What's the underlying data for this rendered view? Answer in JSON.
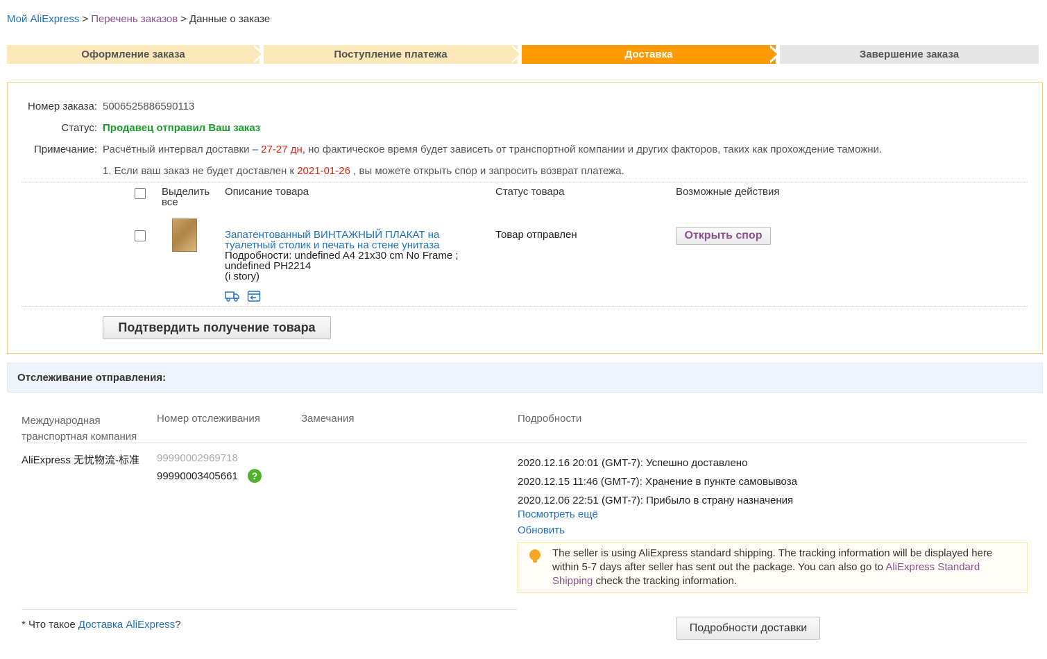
{
  "breadcrumb": {
    "home": "Мой AliExpress",
    "orders": "Перечень заказов",
    "current": "Данные о заказе",
    "separator": ">"
  },
  "steps": [
    {
      "label": "Оформление заказа",
      "state": "done"
    },
    {
      "label": "Поступление платежа",
      "state": "done"
    },
    {
      "label": "Доставка",
      "state": "active"
    },
    {
      "label": "Завершение заказа",
      "state": "todo"
    }
  ],
  "order": {
    "number_label": "Номер заказа:",
    "number": "5006525886590113",
    "status_label": "Статус:",
    "status": "Продавец отправил Ваш заказ",
    "note_label": "Примечание:",
    "note_prefix": "Расчётный интервал доставки – ",
    "note_interval": "27-27 дн",
    "note_suffix": ", но фактическое время будет зависеть от транспортной компании и других факторов, таких как прохождение таможни.",
    "dispute_prefix": "1. Если ваш заказ не будет доставлен к ",
    "dispute_date": "2021-01-26",
    "dispute_suffix": " , вы можете открыть спор и запросить возврат платежа."
  },
  "products": {
    "select_all": "Выделить все",
    "col_description": "Описание товара",
    "col_status": "Статус товара",
    "col_actions": "Возможные действия",
    "item": {
      "title": "Запатентованный ВИНТАЖНЫЙ ПЛАКАТ на туалетный столик и печать на стене унитаза",
      "details_line1": "Подробности: undefined A4 21x30 cm No Frame   ;",
      "details_line2": "undefined PH2214",
      "store": "(i story)",
      "status": "Товар отправлен",
      "action": "Открыть спор"
    },
    "confirm_button": "Подтвердить получение товара"
  },
  "tracking": {
    "title": "Отслеживание отправления:",
    "col_carrier_1": "Международная",
    "col_carrier_2": "транспортная компания",
    "col_number": "Номер отслеживания",
    "col_remarks": "Замечания",
    "col_details": "Подробности",
    "carrier": "AliExpress 无忧物流-标准",
    "old_number": "99990002969718",
    "number": "99990003405661",
    "events": [
      "2020.12.16 20:01 (GMT-7): Успешно доставлено",
      "2020.12.15 11:46 (GMT-7): Хранение в пункте самовывоза",
      "2020.12.06 22:51 (GMT-7): Прибыло в страну назначения"
    ],
    "more_link": "Посмотреть ещё",
    "refresh_link": "Обновить",
    "notice_text": "The seller is using AliExpress standard shipping. The tracking information will be displayed here within 5-7 days after seller has sent out the package. You can also go to ",
    "notice_link": "AliExpress Standard Shipping",
    "notice_suffix": " check the tracking information.",
    "faq_prefix": "* Что такое ",
    "faq_link": "Доставка AliExpress",
    "faq_suffix": "?",
    "details_button": "Подробности доставки"
  },
  "colors": {
    "step_done": "#fde8b9",
    "step_active": "#ff9b00",
    "step_todo": "#e6e6e6",
    "status_green": "#1a9c2c",
    "highlight_red": "#e4230e",
    "link_blue": "#1d6fbf"
  }
}
